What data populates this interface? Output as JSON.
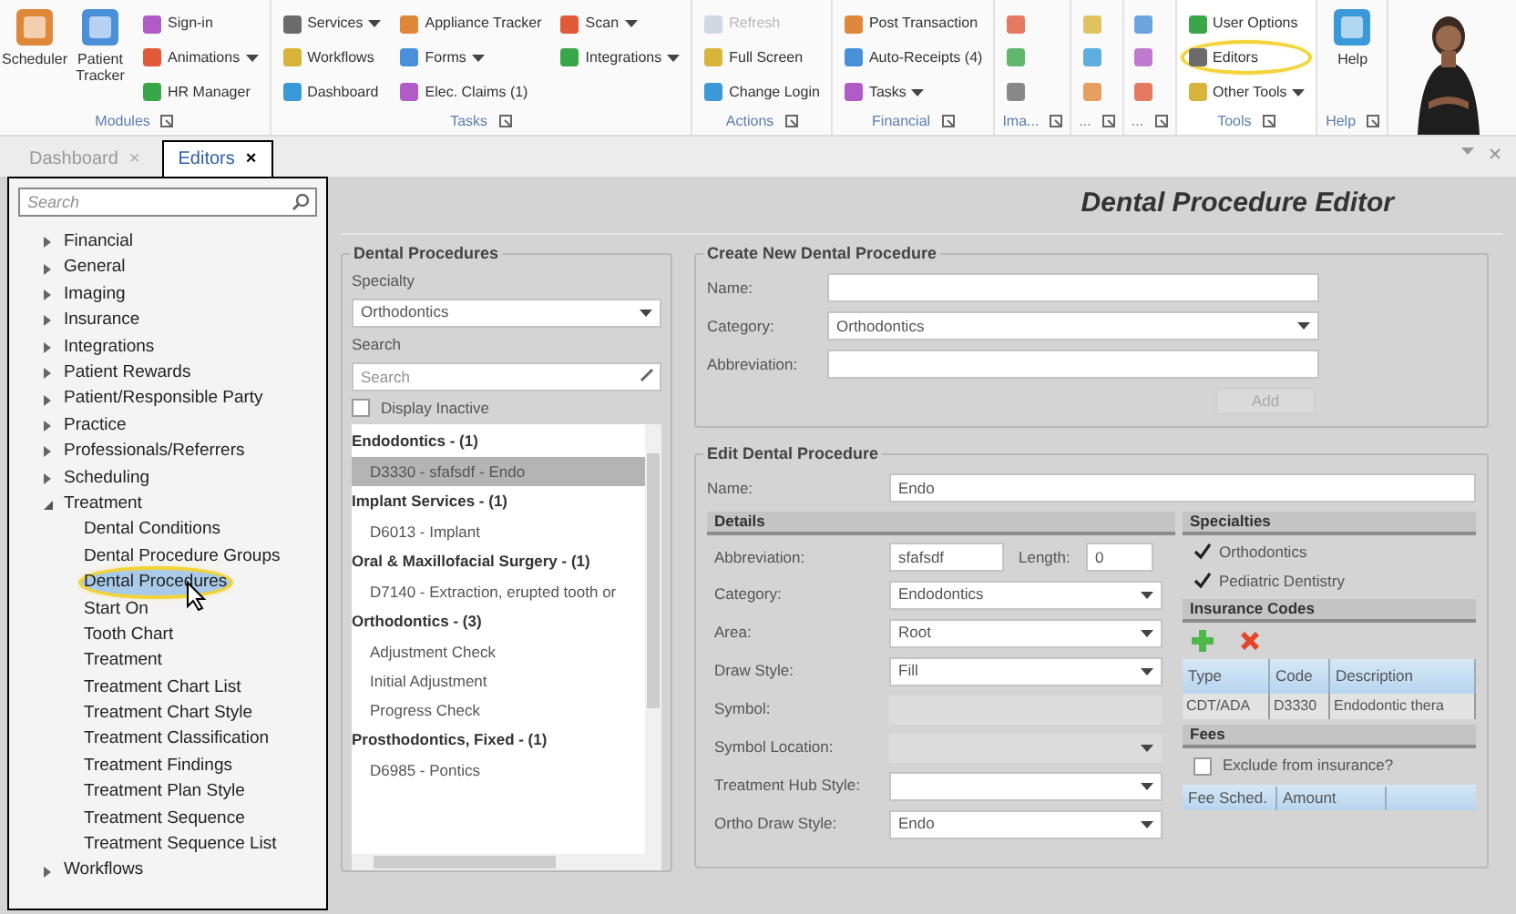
{
  "ribbon": {
    "groups": [
      {
        "label": "Modules",
        "buttons": [
          {
            "kind": "large",
            "label": "Scheduler"
          },
          {
            "kind": "large",
            "label": "Patient Tracker"
          },
          {
            "kind": "small",
            "label": "Sign-in"
          },
          {
            "kind": "small",
            "label": "Animations",
            "dropdown": true
          },
          {
            "kind": "small",
            "label": "HR Manager"
          }
        ]
      },
      {
        "label": "Tasks",
        "buttons": [
          {
            "kind": "small",
            "label": "Services",
            "dropdown": true
          },
          {
            "kind": "small",
            "label": "Workflows"
          },
          {
            "kind": "small",
            "label": "Dashboard"
          },
          {
            "kind": "small",
            "label": "Appliance Tracker"
          },
          {
            "kind": "small",
            "label": "Forms",
            "dropdown": true
          },
          {
            "kind": "small",
            "label": "Elec. Claims (1)"
          },
          {
            "kind": "small",
            "label": "Scan",
            "dropdown": true
          },
          {
            "kind": "small",
            "label": "Integrations",
            "dropdown": true
          }
        ]
      },
      {
        "label": "Actions",
        "buttons": [
          {
            "kind": "small",
            "label": "Refresh",
            "disabled": true
          },
          {
            "kind": "small",
            "label": "Full Screen",
            "disabled": false
          },
          {
            "kind": "small",
            "label": "Change Login",
            "disabled": false
          }
        ]
      },
      {
        "label": "Financial",
        "buttons": [
          {
            "kind": "small",
            "label": "Post Transaction"
          },
          {
            "kind": "small",
            "label": "Auto-Receipts (4)"
          },
          {
            "kind": "small",
            "label": "Tasks",
            "dropdown": true
          }
        ]
      },
      {
        "label": "Ima...",
        "buttons": [
          {
            "kind": "icon"
          },
          {
            "kind": "icon"
          },
          {
            "kind": "icon"
          }
        ]
      },
      {
        "label": "...",
        "buttons": [
          {
            "kind": "icon"
          },
          {
            "kind": "icon"
          },
          {
            "kind": "icon"
          }
        ]
      },
      {
        "label": "...",
        "buttons": [
          {
            "kind": "icon"
          },
          {
            "kind": "icon"
          },
          {
            "kind": "icon"
          }
        ]
      },
      {
        "label": "Tools",
        "buttons": [
          {
            "kind": "small",
            "label": "User Options",
            "highlighted": false
          },
          {
            "kind": "small",
            "label": "Editors",
            "highlighted": true
          },
          {
            "kind": "small",
            "label": "Other Tools",
            "dropdown": true,
            "highlighted": false
          }
        ]
      },
      {
        "label": "Help",
        "buttons": [
          {
            "kind": "large",
            "label": "Help"
          }
        ]
      }
    ]
  },
  "tabs": [
    {
      "label": "Dashboard",
      "close": "×",
      "selected": false
    },
    {
      "label": "Editors",
      "close": "×",
      "selected": true
    }
  ],
  "navigator": {
    "search": {
      "placeholder": "Search"
    },
    "items": [
      {
        "label": "Financial",
        "expanded": false
      },
      {
        "label": "General",
        "expanded": false
      },
      {
        "label": "Imaging",
        "expanded": false
      },
      {
        "label": "Insurance",
        "expanded": false
      },
      {
        "label": "Integrations",
        "expanded": false
      },
      {
        "label": "Patient Rewards",
        "expanded": false
      },
      {
        "label": "Patient/Responsible Party",
        "expanded": false
      },
      {
        "label": "Practice",
        "expanded": false
      },
      {
        "label": "Professionals/Referrers",
        "expanded": false
      },
      {
        "label": "Scheduling",
        "expanded": false
      },
      {
        "label": "Treatment",
        "expanded": true,
        "children": [
          {
            "label": "Dental Conditions",
            "selected": false,
            "highlighted": false
          },
          {
            "label": "Dental Procedure Groups",
            "selected": false,
            "highlighted": false
          },
          {
            "label": "Dental Procedures",
            "selected": true,
            "highlighted": true
          },
          {
            "label": "Start On",
            "selected": false,
            "highlighted": false
          },
          {
            "label": "Tooth Chart",
            "selected": false,
            "highlighted": false
          },
          {
            "label": "Treatment",
            "selected": false,
            "highlighted": false
          },
          {
            "label": "Treatment Chart List",
            "selected": false,
            "highlighted": false
          },
          {
            "label": "Treatment Chart Style",
            "selected": false,
            "highlighted": false
          },
          {
            "label": "Treatment Classification",
            "selected": false,
            "highlighted": false
          },
          {
            "label": "Treatment Findings",
            "selected": false,
            "highlighted": false
          },
          {
            "label": "Treatment Plan Style",
            "selected": false,
            "highlighted": false
          },
          {
            "label": "Treatment Sequence",
            "selected": false,
            "highlighted": false
          },
          {
            "label": "Treatment Sequence List",
            "selected": false,
            "highlighted": false
          }
        ]
      },
      {
        "label": "Workflows",
        "expanded": false
      }
    ]
  },
  "editor": {
    "title": "Dental Procedure Editor",
    "procedures": {
      "title": "Dental Procedures",
      "specialty_label": "Specialty",
      "specialty": "Orthodontics",
      "search_label": "Search",
      "search_placeholder": "Search",
      "display_inactive": {
        "label": "Display Inactive",
        "checked": false
      },
      "groups": [
        {
          "label": "Endodontics - (1)",
          "items": [
            {
              "label": "D3330 - sfafsdf - Endo",
              "selected": true
            }
          ]
        },
        {
          "label": "Implant Services - (1)",
          "items": [
            {
              "label": "D6013 - Implant",
              "selected": false
            }
          ]
        },
        {
          "label": "Oral & Maxillofacial Surgery - (1)",
          "items": [
            {
              "label": "D7140 - Extraction, erupted tooth or",
              "selected": false
            }
          ]
        },
        {
          "label": "Orthodontics - (3)",
          "items": [
            {
              "label": "Adjustment Check",
              "selected": false
            },
            {
              "label": "Initial Adjustment",
              "selected": false
            },
            {
              "label": "Progress Check",
              "selected": false
            }
          ]
        },
        {
          "label": "Prosthodontics, Fixed - (1)",
          "items": [
            {
              "label": "D6985 - Pontics",
              "selected": false
            }
          ]
        }
      ]
    },
    "create": {
      "title": "Create New Dental Procedure",
      "fields": [
        {
          "label": "Name:",
          "kind": "text"
        },
        {
          "label": "Category:",
          "kind": "select",
          "value": "Orthodontics"
        },
        {
          "label": "Abbreviation:",
          "kind": "text"
        }
      ],
      "add_button": "Add"
    },
    "edit": {
      "title": "Edit Dental Procedure",
      "name_label": "Name:",
      "name": "Endo",
      "details": {
        "title": "Details",
        "abbreviation_label": "Abbreviation:",
        "abbreviation": "sfafsdf",
        "length_label": "Length:",
        "length": "0",
        "fields": [
          {
            "label": "Category:",
            "kind": "select",
            "value": "Endodontics",
            "disabled": false
          },
          {
            "label": "Area:",
            "kind": "select",
            "value": "Root",
            "disabled": false
          },
          {
            "label": "Draw Style:",
            "kind": "select",
            "value": "Fill",
            "disabled": false
          },
          {
            "label": "Symbol:",
            "kind": "text",
            "disabled": true
          },
          {
            "label": "Symbol Location:",
            "kind": "select",
            "disabled": true
          },
          {
            "label": "Treatment Hub Style:",
            "kind": "select",
            "disabled": false
          },
          {
            "label": "Ortho Draw Style:",
            "kind": "select",
            "value": "Endo",
            "disabled": false
          }
        ]
      },
      "specialties": {
        "title": "Specialties",
        "items": [
          {
            "label": "Orthodontics",
            "checked": true
          },
          {
            "label": "Pediatric Dentistry",
            "checked": true
          }
        ]
      },
      "insurance_codes": {
        "title": "Insurance Codes",
        "columns": [
          "Type",
          "Code",
          "Description"
        ],
        "rows": [
          [
            "CDT/ADA",
            "D3330",
            "Endodontic thera"
          ]
        ]
      },
      "fees": {
        "title": "Fees",
        "exclude": {
          "label": "Exclude from insurance?",
          "checked": false
        },
        "columns": [
          "Fee Sched.",
          "Amount"
        ]
      }
    }
  }
}
